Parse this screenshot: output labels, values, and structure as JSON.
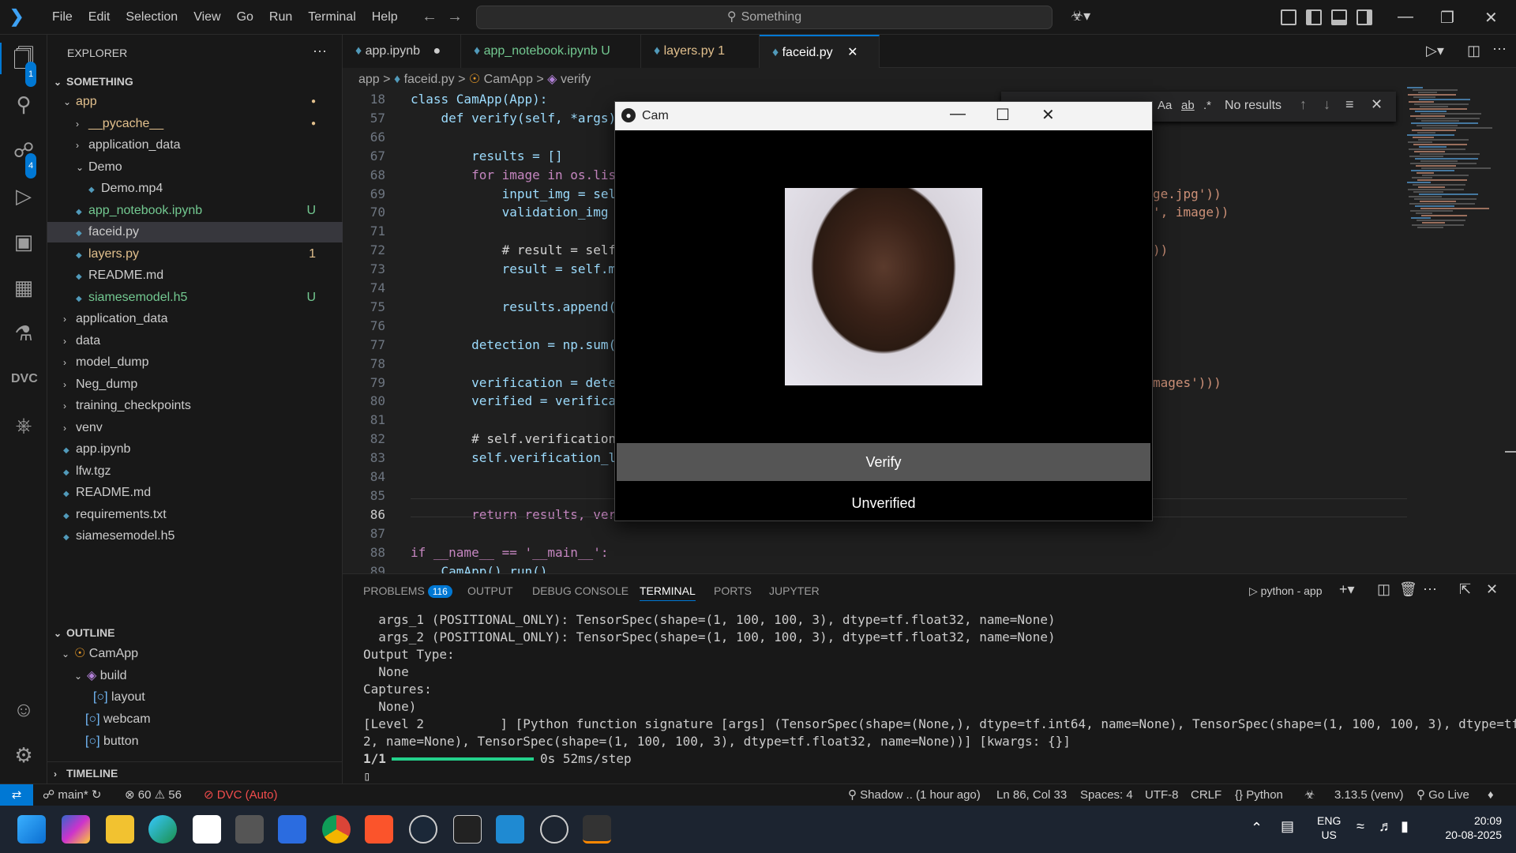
{
  "menu": [
    "File",
    "Edit",
    "Selection",
    "View",
    "Go",
    "Run",
    "Terminal",
    "Help"
  ],
  "search_text": "Something",
  "explorer": {
    "title": "EXPLORER",
    "root": "SOMETHING",
    "items": [
      {
        "label": "app",
        "indent": 0,
        "type": "folder-open",
        "status": "dot"
      },
      {
        "label": "__pycache__",
        "indent": 1,
        "type": "folder",
        "status": "dot"
      },
      {
        "label": "application_data",
        "indent": 1,
        "type": "folder",
        "status": ""
      },
      {
        "label": "Demo",
        "indent": 1,
        "type": "folder-open",
        "status": ""
      },
      {
        "label": "Demo.mp4",
        "indent": 2,
        "type": "file",
        "status": ""
      },
      {
        "label": "app_notebook.ipynb",
        "indent": 1,
        "type": "file",
        "status": "U"
      },
      {
        "label": "faceid.py",
        "indent": 1,
        "type": "file",
        "status": ""
      },
      {
        "label": "layers.py",
        "indent": 1,
        "type": "file",
        "status": "1"
      },
      {
        "label": "README.md",
        "indent": 1,
        "type": "file",
        "status": ""
      },
      {
        "label": "siamesemodel.h5",
        "indent": 1,
        "type": "file",
        "status": "U"
      },
      {
        "label": "application_data",
        "indent": 0,
        "type": "folder",
        "status": ""
      },
      {
        "label": "data",
        "indent": 0,
        "type": "folder",
        "status": ""
      },
      {
        "label": "model_dump",
        "indent": 0,
        "type": "folder",
        "status": ""
      },
      {
        "label": "Neg_dump",
        "indent": 0,
        "type": "folder",
        "status": ""
      },
      {
        "label": "training_checkpoints",
        "indent": 0,
        "type": "folder",
        "status": ""
      },
      {
        "label": "venv",
        "indent": 0,
        "type": "folder",
        "status": ""
      },
      {
        "label": "app.ipynb",
        "indent": 0,
        "type": "file",
        "status": ""
      },
      {
        "label": "lfw.tgz",
        "indent": 0,
        "type": "file",
        "status": ""
      },
      {
        "label": "README.md",
        "indent": 0,
        "type": "file",
        "status": ""
      },
      {
        "label": "requirements.txt",
        "indent": 0,
        "type": "file",
        "status": ""
      },
      {
        "label": "siamesemodel.h5",
        "indent": 0,
        "type": "file",
        "status": ""
      }
    ]
  },
  "outline": {
    "title": "OUTLINE",
    "items": [
      "CamApp",
      "build",
      "layout",
      "webcam",
      "button"
    ]
  },
  "timeline_title": "TIMELINE",
  "tabs": [
    {
      "label": "app.ipynb",
      "suffix": "●"
    },
    {
      "label": "app_notebook.ipynb",
      "suffix": "U"
    },
    {
      "label": "layers.py",
      "suffix": "1"
    },
    {
      "label": "faceid.py",
      "suffix": "✕"
    }
  ],
  "breadcrumb": [
    "app",
    ">",
    "faceid.py",
    ">",
    "CamApp",
    ">",
    "verify"
  ],
  "find": {
    "results": "No results",
    "opt1": "Aa",
    "opt2": "ab",
    "opt3": ".*"
  },
  "code_lines": [
    {
      "n": "18",
      "text": "class CamApp(App):"
    },
    {
      "n": "57",
      "text": "    def verify(self, *args):"
    },
    {
      "n": "66",
      "text": ""
    },
    {
      "n": "67",
      "text": "        results = []"
    },
    {
      "n": "68",
      "text": "        for image in os.lis"
    },
    {
      "n": "69",
      "text": "            input_img = sel"
    },
    {
      "n": "70",
      "text": "            validation_img "
    },
    {
      "n": "71",
      "text": ""
    },
    {
      "n": "72",
      "text": "            # result = self"
    },
    {
      "n": "73",
      "text": "            result = self.m"
    },
    {
      "n": "74",
      "text": ""
    },
    {
      "n": "75",
      "text": "            results.append("
    },
    {
      "n": "76",
      "text": ""
    },
    {
      "n": "77",
      "text": "        detection = np.sum("
    },
    {
      "n": "78",
      "text": ""
    },
    {
      "n": "79",
      "text": "        verification = dete"
    },
    {
      "n": "80",
      "text": "        verified = verifica"
    },
    {
      "n": "81",
      "text": ""
    },
    {
      "n": "82",
      "text": "        # self.verification"
    },
    {
      "n": "83",
      "text": "        self.verification_l"
    },
    {
      "n": "84",
      "text": ""
    },
    {
      "n": "85",
      "text": ""
    },
    {
      "n": "86",
      "text": "        return results, ver"
    },
    {
      "n": "87",
      "text": ""
    },
    {
      "n": "88",
      "text": "if __name__ == '__main__':"
    },
    {
      "n": "89",
      "text": "    CamApp().run()"
    }
  ],
  "code_right": [
    {
      "line": "69",
      "text": "ge.jpg'))"
    },
    {
      "line": "70",
      "text": "', image))"
    },
    {
      "line": "72",
      "text": "))"
    },
    {
      "line": "79",
      "text": "mages')))"
    }
  ],
  "cam_window": {
    "title": "Cam",
    "button": "Verify",
    "status": "Unverified"
  },
  "panel": {
    "tabs": [
      "PROBLEMS",
      "OUTPUT",
      "DEBUG CONSOLE",
      "TERMINAL",
      "PORTS",
      "JUPYTER"
    ],
    "problems_count": "116",
    "active": "TERMINAL",
    "terminal_name": "python - app",
    "lines": [
      "  args_1 (POSITIONAL_ONLY): TensorSpec(shape=(1, 100, 100, 3), dtype=tf.float32, name=None)",
      "  args_2 (POSITIONAL_ONLY): TensorSpec(shape=(1, 100, 100, 3), dtype=tf.float32, name=None)",
      "Output Type:",
      "  None",
      "Captures:",
      "  None)",
      "[Level 2          ] [Python function signature [args] (TensorSpec(shape=(None,), dtype=tf.int64, name=None), TensorSpec(shape=(1, 100, 100, 3), dtype=tf.float3",
      "2, name=None), TensorSpec(shape=(1, 100, 100, 3), dtype=tf.float32, name=None))] [kwargs: {}]"
    ],
    "progress_label": "1/1",
    "progress_text": "0s 52ms/step",
    "progress": 1.0
  },
  "status": {
    "branch": "main*",
    "errors": "60",
    "warnings": "56",
    "dvc": "DVC (Auto)",
    "blame": "Shadow .. (1 hour ago)",
    "position": "Ln 86, Col 33",
    "spaces": "Spaces: 4",
    "encoding": "UTF-8",
    "eol": "CRLF",
    "language": "Python",
    "interpreter": "3.13.5 (venv)",
    "golive": "Go Live"
  },
  "taskbar": {
    "lang1": "ENG",
    "lang2": "US",
    "time": "20:09",
    "date": "20-08-2025"
  },
  "activity_badges": {
    "explorer": "1",
    "scm": "4"
  }
}
